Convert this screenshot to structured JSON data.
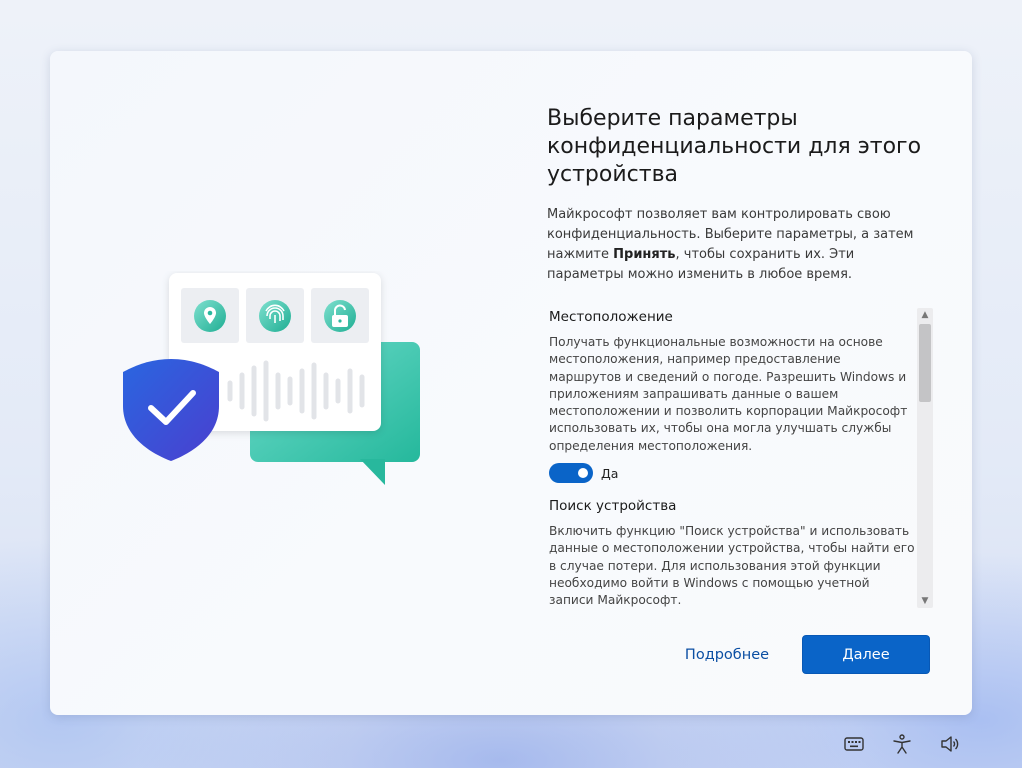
{
  "dialog": {
    "title": "Выберите параметры конфиденциальности для этого устройства",
    "intro_before": "Майкрософт позволяет вам контролировать свою конфиденциальность. Выберите параметры, а затем нажмите ",
    "intro_bold": "Принять",
    "intro_after": ", чтобы сохранить их. Эти параметры можно изменить в любое время.",
    "sections": [
      {
        "title": "Местоположение",
        "description": "Получать функциональные возможности на основе местоположения, например предоставление маршрутов и сведений о погоде. Разрешить Windows и приложениям запрашивать данные о вашем местоположении и позволить корпорации Майкрософт использовать их, чтобы она могла улучшать службы определения местоположения.",
        "toggle_on": true,
        "toggle_label": "Да"
      },
      {
        "title": "Поиск устройства",
        "description": "Включить функцию \"Поиск устройства\" и использовать данные о местоположении устройства, чтобы найти его в случае потери. Для использования этой функции необходимо войти в Windows с помощью учетной записи Майкрософт."
      }
    ],
    "learn_more_label": "Подробнее",
    "next_label": "Далее"
  },
  "colors": {
    "accent": "#0a64c8",
    "shield": "#2f5bd6",
    "chat_bubble": "#3cc8b0"
  },
  "illustration": {
    "icons": [
      "location-pin-icon",
      "fingerprint-icon",
      "unlock-icon",
      "shield-check-icon",
      "voice-wave-icon"
    ]
  },
  "taskbar": {
    "icons": [
      "keyboard-icon",
      "accessibility-icon",
      "volume-icon"
    ]
  }
}
